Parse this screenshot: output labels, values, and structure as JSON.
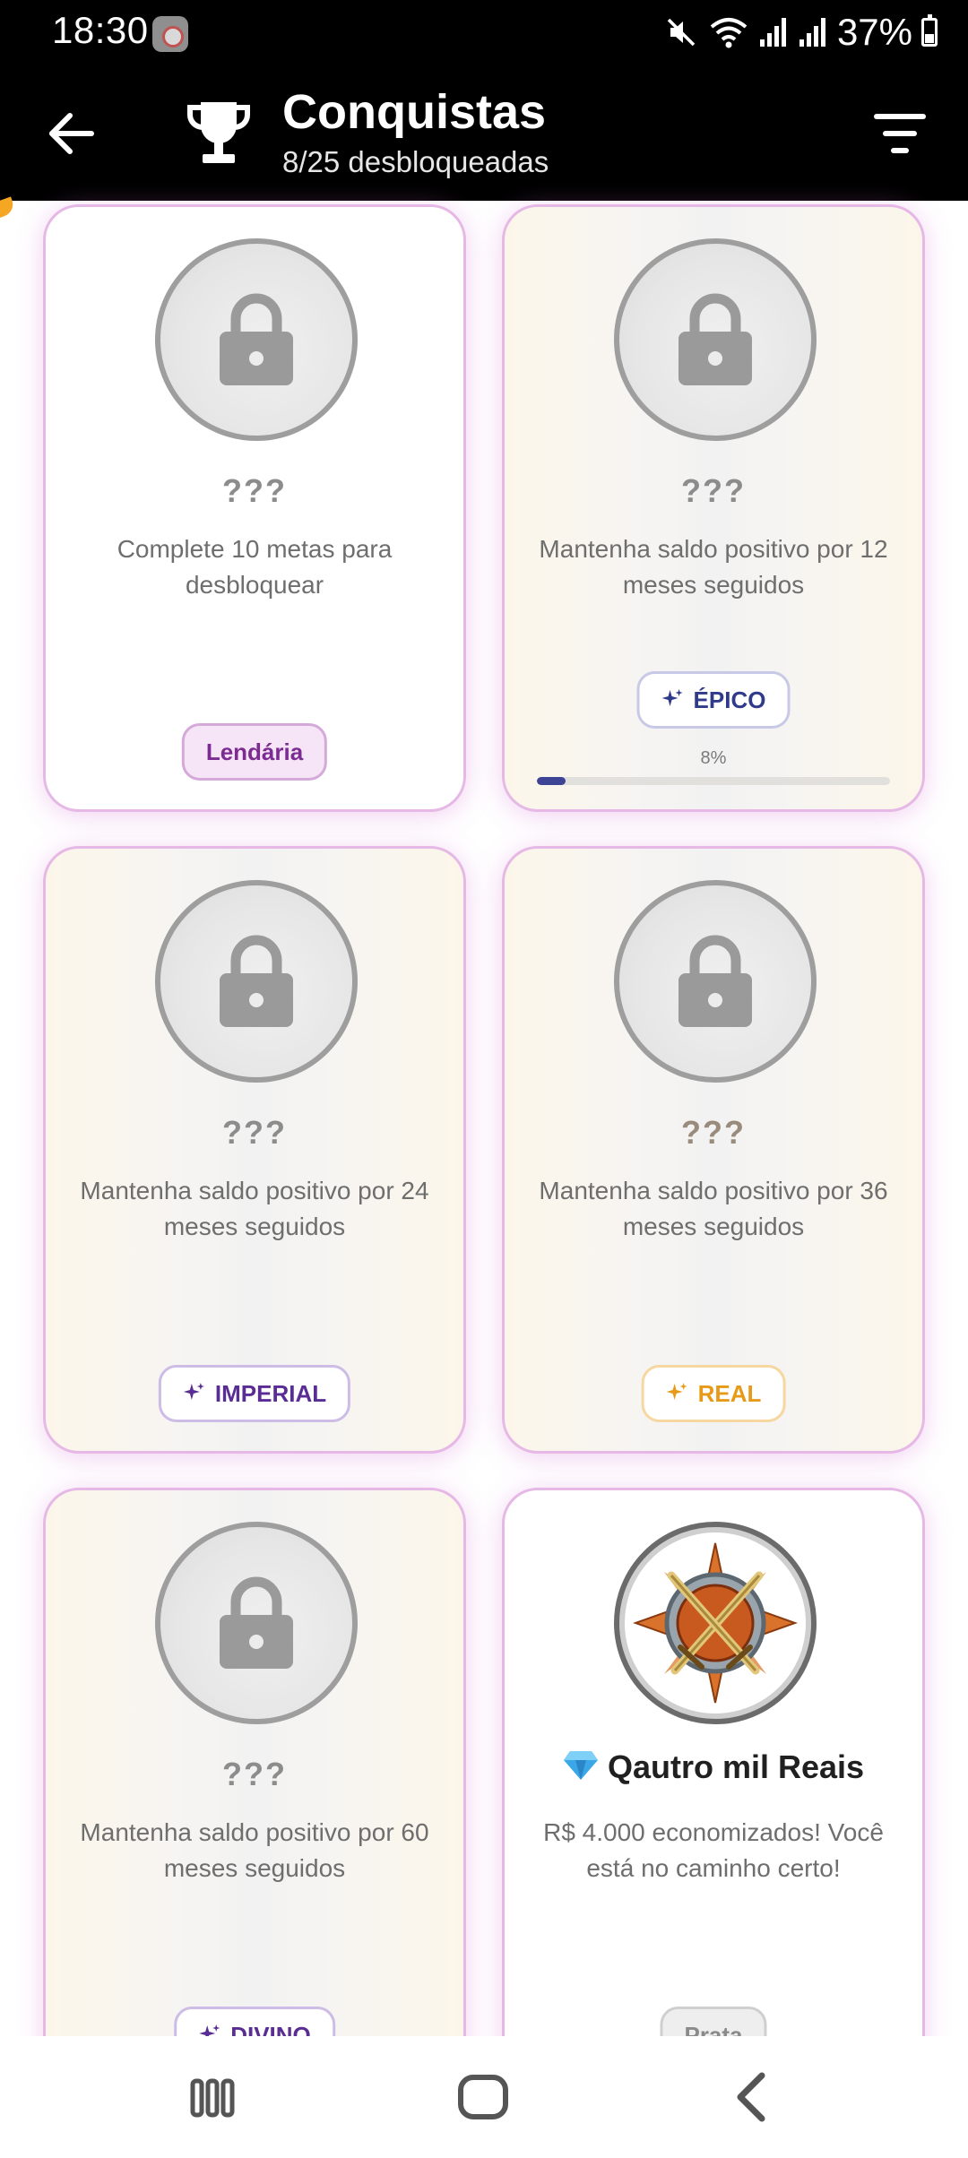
{
  "status_bar": {
    "time": "18:30",
    "battery_text": "37%",
    "battery_level": 0.37
  },
  "app_bar": {
    "title": "Conquistas",
    "subtitle": "8/25 desbloqueadas",
    "icons": [
      "back-arrow-icon",
      "trophy-icon",
      "filter-icon"
    ]
  },
  "cards": [
    {
      "title": "???",
      "description": "Complete 10 metas para desbloquear",
      "rarity": "Lendária",
      "locked": true
    },
    {
      "title": "???",
      "description": "Mantenha saldo positivo por 12 meses seguidos",
      "rarity": "ÉPICO",
      "locked": true,
      "progress_text": "8%",
      "progress": 0.08
    },
    {
      "title": "???",
      "description": "Mantenha saldo positivo por 24 meses seguidos",
      "rarity": "IMPERIAL",
      "locked": true
    },
    {
      "title": "???",
      "description": "Mantenha saldo positivo por 36 meses seguidos",
      "rarity": "REAL",
      "locked": true
    },
    {
      "title": "???",
      "description": "Mantenha saldo positivo por 60 meses seguidos",
      "rarity": "DIVINO",
      "locked": true
    },
    {
      "title": "Qautro mil Reais",
      "description": "R$ 4.000 economizados! Você está no caminho certo!",
      "rarity": "Prata",
      "locked": false,
      "icon": "crossed-swords-medal-icon"
    }
  ],
  "colors": {
    "appbar": "#000000",
    "card_border": "#e5b8e5",
    "epico": "#2f3a8a",
    "imperial": "#5a2d94",
    "real": "#e69a17",
    "lendaria": "#7b2b91"
  },
  "nav_bar": {
    "icons": [
      "recent-apps-icon",
      "home-icon",
      "system-back-icon"
    ]
  }
}
